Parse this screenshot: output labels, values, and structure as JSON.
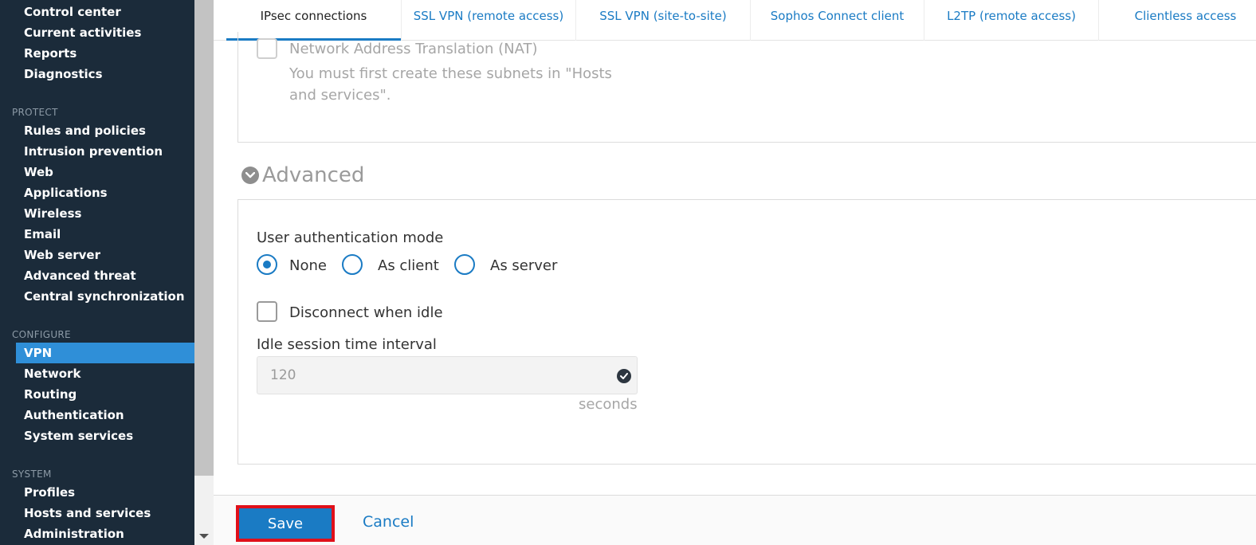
{
  "sidebar": {
    "items_top": [
      "Control center",
      "Current activities",
      "Reports",
      "Diagnostics"
    ],
    "protect_label": "PROTECT",
    "protect_items": [
      "Rules and policies",
      "Intrusion prevention",
      "Web",
      "Applications",
      "Wireless",
      "Email",
      "Web server",
      "Advanced threat",
      "Central synchronization"
    ],
    "configure_label": "CONFIGURE",
    "configure_items": [
      "VPN",
      "Network",
      "Routing",
      "Authentication",
      "System services"
    ],
    "system_label": "SYSTEM",
    "system_items": [
      "Profiles",
      "Hosts and services",
      "Administration"
    ]
  },
  "tabs": [
    "IPsec connections",
    "SSL VPN (remote access)",
    "SSL VPN (site-to-site)",
    "Sophos Connect client",
    "L2TP (remote access)",
    "Clientless access"
  ],
  "nat_section": {
    "checkbox_label": "Network Address Translation (NAT)",
    "hint_line1": "You must first create these subnets in \"Hosts",
    "hint_line2": "and services\"."
  },
  "advanced": {
    "title": "Advanced",
    "auth_mode_label": "User authentication mode",
    "auth_modes": [
      "None",
      "As client",
      "As server"
    ],
    "auth_mode_selected": "None",
    "disconnect_idle_label": "Disconnect when idle",
    "disconnect_idle_checked": false,
    "idle_interval_label": "Idle session time interval",
    "idle_interval_value": "120",
    "idle_interval_unit": "seconds"
  },
  "footer": {
    "save_label": "Save",
    "cancel_label": "Cancel"
  },
  "colors": {
    "sidebar_bg": "#1b2b3a",
    "accent": "#1a7bc4",
    "active_nav": "#2f8fd8",
    "highlight_border": "#e0101a"
  }
}
